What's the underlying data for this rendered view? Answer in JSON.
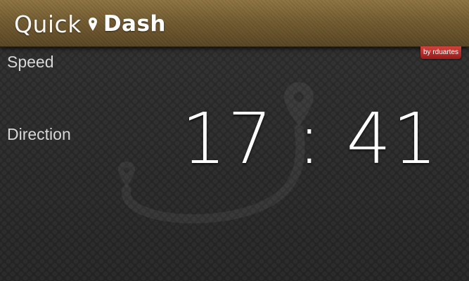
{
  "header": {
    "title_part1": "Quick",
    "title_part2": "Dash",
    "logo_icon": "map-pin-icon"
  },
  "badge": {
    "label": "by rduartes"
  },
  "labels": {
    "speed": "Speed",
    "direction": "Direction"
  },
  "clock": {
    "hours": "17",
    "separator": ":",
    "minutes": "41"
  },
  "colors": {
    "header_top": "#8e7442",
    "header_bottom": "#5a4624",
    "background": "#262626",
    "badge": "#b52d29",
    "text": "#ffffff"
  }
}
